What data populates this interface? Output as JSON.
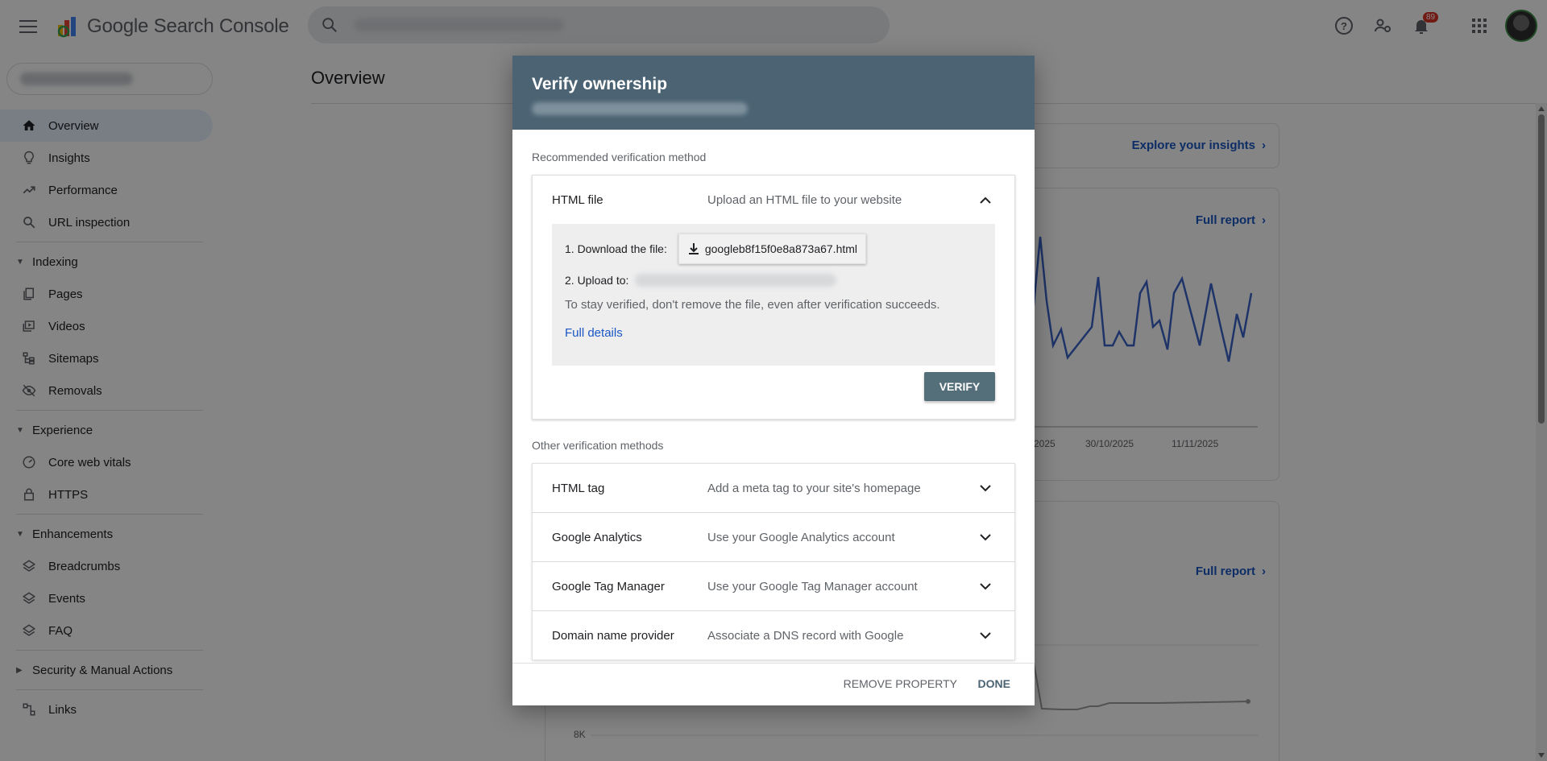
{
  "app": {
    "title": "Google Search Console"
  },
  "topbar": {
    "notification_count": "89"
  },
  "sidebar": {
    "items": [
      {
        "label": "Overview",
        "icon": "home-icon",
        "active": true
      },
      {
        "label": "Insights",
        "icon": "lightbulb-icon"
      },
      {
        "label": "Performance",
        "icon": "trending-up-icon"
      },
      {
        "label": "URL inspection",
        "icon": "search-icon"
      }
    ],
    "indexing": {
      "title": "Indexing",
      "items": [
        {
          "label": "Pages",
          "icon": "pages-icon"
        },
        {
          "label": "Videos",
          "icon": "video-icon"
        },
        {
          "label": "Sitemaps",
          "icon": "sitemap-icon"
        },
        {
          "label": "Removals",
          "icon": "eye-off-icon"
        }
      ]
    },
    "experience": {
      "title": "Experience",
      "items": [
        {
          "label": "Core web vitals",
          "icon": "speed-icon"
        },
        {
          "label": "HTTPS",
          "icon": "lock-icon"
        }
      ]
    },
    "enhancements": {
      "title": "Enhancements",
      "items": [
        {
          "label": "Breadcrumbs",
          "icon": "layers-icon"
        },
        {
          "label": "Events",
          "icon": "layers-icon"
        },
        {
          "label": "FAQ",
          "icon": "layers-icon"
        }
      ]
    },
    "security": {
      "title": "Security & Manual Actions"
    },
    "links": {
      "label": "Links",
      "icon": "links-icon"
    }
  },
  "main": {
    "title": "Overview",
    "explore_link": "Explore your insights",
    "full_report_1": "Full report",
    "full_report_2": "Full report",
    "x_labels": [
      "2025",
      "30/10/2025",
      "11/11/2025"
    ],
    "y_label_8k": "8K"
  },
  "dialog": {
    "title": "Verify ownership",
    "recommended_label": "Recommended verification method",
    "recommended": {
      "name": "HTML file",
      "desc": "Upload an HTML file to your website",
      "step1": "1. Download the file:",
      "file_name": "googleb8f15f0e8a873a67.html",
      "step2": "2. Upload to:",
      "stay_text": "To stay verified, don't remove the file, even after verification succeeds.",
      "full_details": "Full details",
      "verify": "VERIFY"
    },
    "other_label": "Other verification methods",
    "others": [
      {
        "name": "HTML tag",
        "desc": "Add a meta tag to your site's homepage"
      },
      {
        "name": "Google Analytics",
        "desc": "Use your Google Analytics account"
      },
      {
        "name": "Google Tag Manager",
        "desc": "Use your Google Tag Manager account"
      },
      {
        "name": "Domain name provider",
        "desc": "Associate a DNS record with Google"
      }
    ],
    "remove_property": "REMOVE PROPERTY",
    "done": "DONE"
  },
  "colors": {
    "header": "#4b6373",
    "accent_blue": "#1a57c4",
    "verify_button": "#546e7a"
  }
}
